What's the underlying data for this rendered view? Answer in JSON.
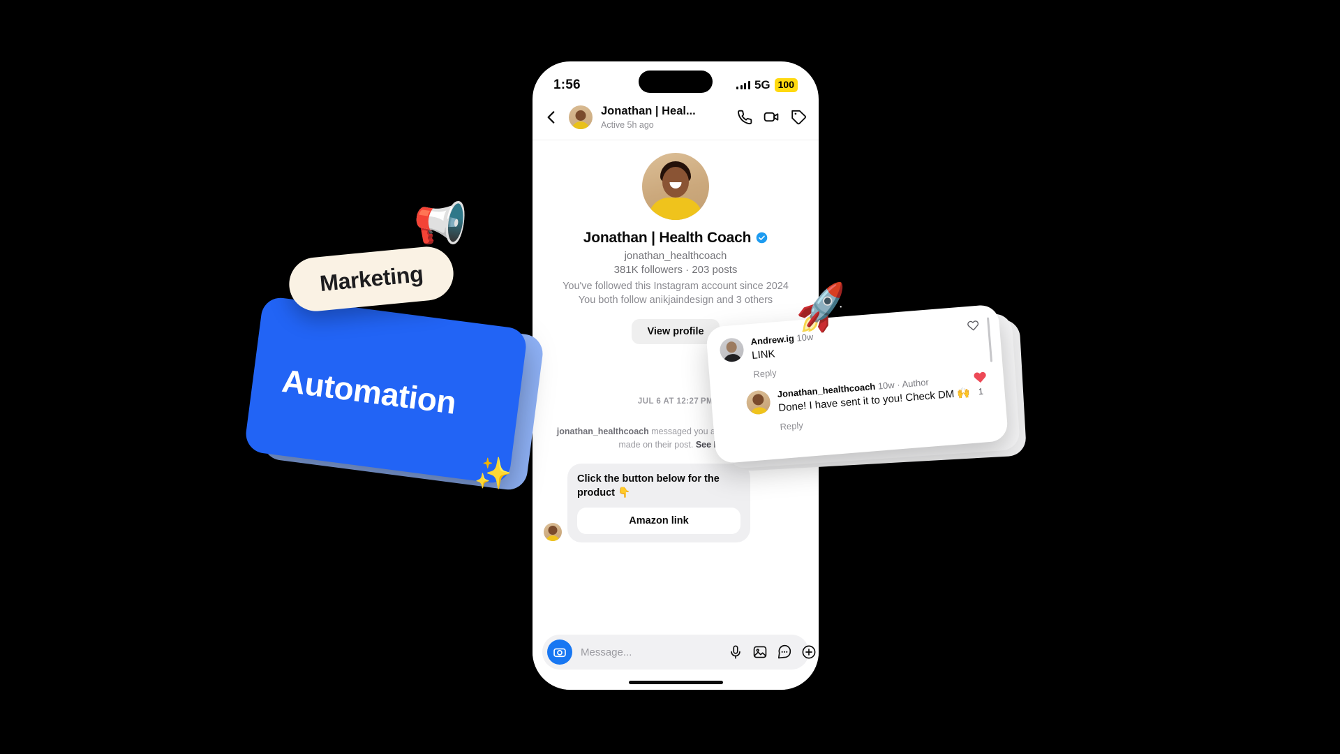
{
  "status_bar": {
    "time": "1:56",
    "network": "5G",
    "battery": "100",
    "signal_icon": "signal-bars-icon"
  },
  "chat_header": {
    "back_icon": "back-chevron-icon",
    "avatar": "contact-avatar",
    "name": "Jonathan | Heal...",
    "status": "Active 5h ago",
    "call_icon": "phone-call-icon",
    "video_icon": "video-call-icon",
    "tag_icon": "price-tag-icon"
  },
  "profile": {
    "avatar": "profile-avatar",
    "display_name": "Jonathan | Health Coach",
    "verified_icon": "verified-badge-icon",
    "handle": "jonathan_healthcoach",
    "stats": "381K followers · 203 posts",
    "followed_since": "You've followed this Instagram account since 2024",
    "mutuals": "You both follow anikjaindesign and 3 others",
    "view_profile_label": "View profile"
  },
  "thread": {
    "day_stamp": "JUL 6 AT 12:27 PM",
    "system_message_user": "jonathan_healthcoach",
    "system_message_text": " messaged you about a comment you made on their post. ",
    "system_message_link": "See Post",
    "message": {
      "avatar": "sender-avatar",
      "text": "Click the button below for the product 👇",
      "cta_label": "Amazon link"
    }
  },
  "composer": {
    "camera_icon": "camera-icon",
    "placeholder": "Message...",
    "mic_icon": "microphone-icon",
    "gallery_icon": "image-gallery-icon",
    "sticker_icon": "sticker-icon",
    "plus_icon": "plus-circle-icon"
  },
  "comment_card": {
    "heart_outline_icon": "heart-outline-icon",
    "scrollbar": "card-scrollbar",
    "comments": [
      {
        "avatar": "andrew-avatar",
        "username": "Andrew.ig",
        "time": "10w",
        "text": "LINK",
        "reply_label": "Reply"
      },
      {
        "avatar": "jonathan-avatar",
        "username": "Jonathan_healthcoach",
        "time": "10w",
        "separator": "·",
        "author_tag": "Author",
        "text": "Done! I have sent it to you! Check DM 🙌",
        "reply_label": "Reply"
      }
    ],
    "like": {
      "icon": "heart-filled-icon",
      "count": "1"
    }
  },
  "decorations": {
    "marketing_label": "Marketing",
    "megaphone_icon": "📢",
    "automation_label": "Automation",
    "sparkles_icon": "✨",
    "rocket_icon": "🚀"
  },
  "colors": {
    "automation_blue": "#2264F5",
    "automation_blue_edge": "#8FB2F7",
    "marketing_cream": "#FAF2E4",
    "battery_yellow": "#FFD90F",
    "instagram_blue": "#1877F2",
    "verified_blue": "#1D9BF0",
    "heart_red": "#ED4956",
    "background": "#000000"
  }
}
